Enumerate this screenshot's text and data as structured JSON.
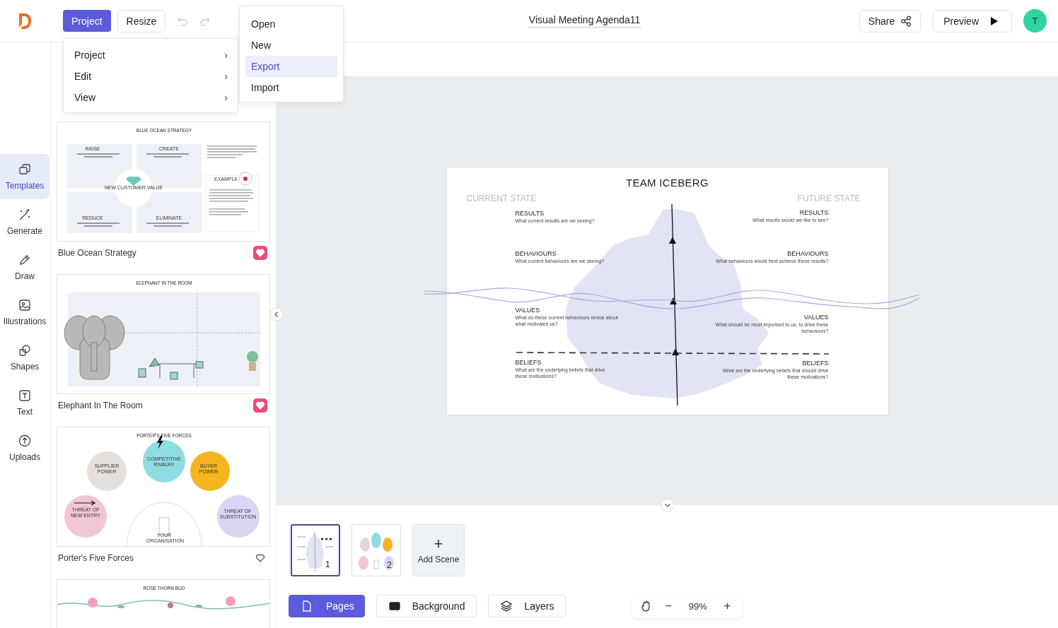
{
  "header": {
    "menu_button": "Project",
    "resize_button": "Resize",
    "title": "Visual Meeting Agenda11",
    "share_button": "Share",
    "preview_button": "Preview",
    "avatar": "T"
  },
  "menu": [
    {
      "label": "Project",
      "arrow": "›"
    },
    {
      "label": "Edit",
      "arrow": "›"
    },
    {
      "label": "View",
      "arrow": "›"
    }
  ],
  "submenu": [
    {
      "label": "Open",
      "selected": false
    },
    {
      "label": "New",
      "selected": false
    },
    {
      "label": "Export",
      "selected": true
    },
    {
      "label": "Import",
      "selected": false
    }
  ],
  "rail": [
    {
      "kind": "templates",
      "label": "Templates",
      "selected": true
    },
    {
      "kind": "generate",
      "label": "Generate",
      "selected": false
    },
    {
      "kind": "draw",
      "label": "Draw",
      "selected": false
    },
    {
      "kind": "illustrations",
      "label": "Illustrations",
      "selected": false
    },
    {
      "kind": "shapes",
      "label": "Shapes",
      "selected": false
    },
    {
      "kind": "text",
      "label": "Text",
      "selected": false
    },
    {
      "kind": "uploads",
      "label": "Uploads",
      "selected": false
    }
  ],
  "templates": [
    {
      "kind": "blue-ocean",
      "title": "BLUE OCEAN STRATEGY",
      "labels": [
        "RAISE",
        "CREATE",
        "EXAMPLE",
        "NEW CUSTOMER VALUE",
        "REDUCE",
        "ELIMINATE"
      ],
      "name": "Blue Ocean Strategy",
      "favorite": true
    },
    {
      "kind": "elephant",
      "title": "ELEPHANT IN THE ROOM",
      "name": "Elephant In The Room",
      "favorite": true
    },
    {
      "kind": "porter",
      "title": "PORTER'S FIVE FORCES",
      "labels": [
        "SUPPLIER POWER",
        "COMPETITIVE RIVALRY",
        "BUYER POWER",
        "THREAT OF NEW ENTRY",
        "THREAT OF SUBSTITUTION",
        "YOUR ORGANISATION"
      ],
      "name": "Porter's Five Forces",
      "favorite": false
    },
    {
      "kind": "rose",
      "title": "ROSE THORN BUD"
    }
  ],
  "canvas": {
    "title": "TEAM ICEBERG",
    "left_heading": "CURRENT STATE",
    "right_heading": "FUTURE STATE",
    "left": [
      {
        "heading": "RESULTS",
        "question": "What current results are we seeing?"
      },
      {
        "heading": "BEHAVIOURS",
        "question": "What current behaviours are we seeing?"
      },
      {
        "heading": "VALUES",
        "question": "What do these current behaviours reveal about what motivates us?"
      },
      {
        "heading": "BELIEFS",
        "question": "What are the underlying beliefs that drive these motivations?"
      }
    ],
    "right": [
      {
        "heading": "RESULTS",
        "question": "What results would we like to see?"
      },
      {
        "heading": "BEHAVIOURS",
        "question": "What behaviours would best achieve these results?"
      },
      {
        "heading": "VALUES",
        "question": "What should be most important to us, to drive these behaviours?"
      },
      {
        "heading": "BELIEFS",
        "question": "What are the underlying beliefs that should drive these motivations?"
      }
    ]
  },
  "scenes": [
    {
      "number": "1",
      "selected": true
    },
    {
      "number": "2",
      "selected": false
    }
  ],
  "add_scene": {
    "icon": "+",
    "label": "Add Scene"
  },
  "toolbar": [
    {
      "kind": "pages",
      "label": "Pages",
      "selected": true
    },
    {
      "kind": "background",
      "label": "Background",
      "selected": false
    },
    {
      "kind": "layers",
      "label": "Layers",
      "selected": false
    }
  ],
  "zoom": {
    "minus": "−",
    "value": "99%",
    "plus": "+"
  }
}
